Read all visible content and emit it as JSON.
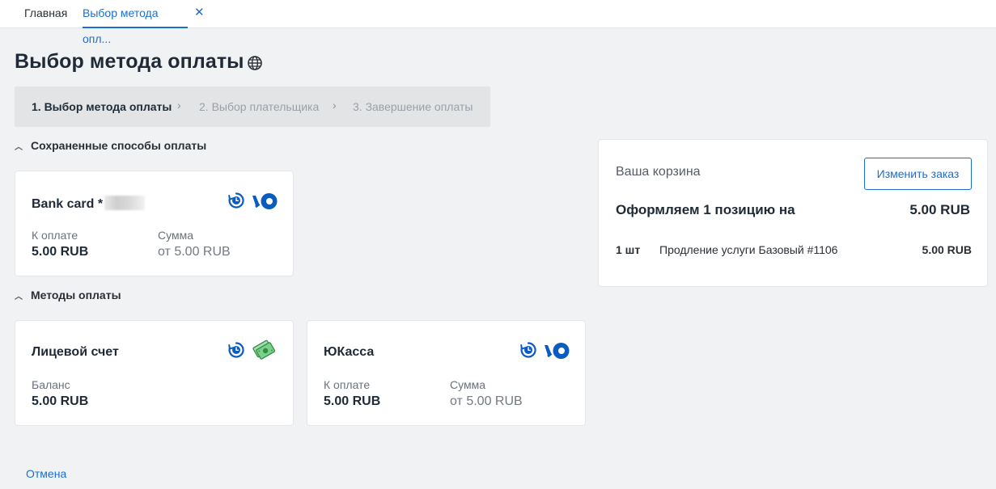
{
  "tabs": {
    "home_label": "Главная",
    "active_label": "Выбор метода опл...",
    "close_glyph": "✕"
  },
  "page": {
    "title": "Выбор метода оплаты",
    "title_icon": "globe-icon"
  },
  "stepper": {
    "steps": [
      "1. Выбор метода оплаты",
      "2. Выбор плательщика",
      "3. Завершение оплаты"
    ],
    "active_step": 1,
    "separator": "›"
  },
  "saved_methods": {
    "header": "Сохраненные способы оплаты",
    "cards": [
      {
        "title": "Bank card *",
        "label_pay": "К оплате",
        "value_pay": "5.00 RUB",
        "label_sum": "Сумма",
        "value_sum": "от 5.00 RUB",
        "icons": [
          "clock-icon",
          "yookassa-logo-icon"
        ]
      }
    ]
  },
  "methods": {
    "header": "Методы оплаты",
    "cards": [
      {
        "title": "Лицевой счет",
        "label_balance": "Баланс",
        "value_balance": "5.00 RUB",
        "icons": [
          "clock-icon",
          "money-icon"
        ]
      },
      {
        "title": "ЮКасса",
        "label_pay": "К оплате",
        "value_pay": "5.00 RUB",
        "label_sum": "Сумма",
        "value_sum": "от 5.00 RUB",
        "icons": [
          "clock-icon",
          "yookassa-logo-icon"
        ]
      }
    ]
  },
  "cart": {
    "title": "Ваша корзина",
    "change_button": "Изменить заказ",
    "summary": "Оформляем 1 позицию на",
    "total": "5.00 RUB",
    "items": [
      {
        "qty": "1 шт",
        "name": "Продление услуги Базовый #1106",
        "price": "5.00 RUB"
      }
    ]
  },
  "footer": {
    "cancel": "Отмена"
  },
  "colors": {
    "accent": "#1a6fd0",
    "yookassa_blue": "#0a5cc1",
    "money_green": "#3aa856"
  }
}
